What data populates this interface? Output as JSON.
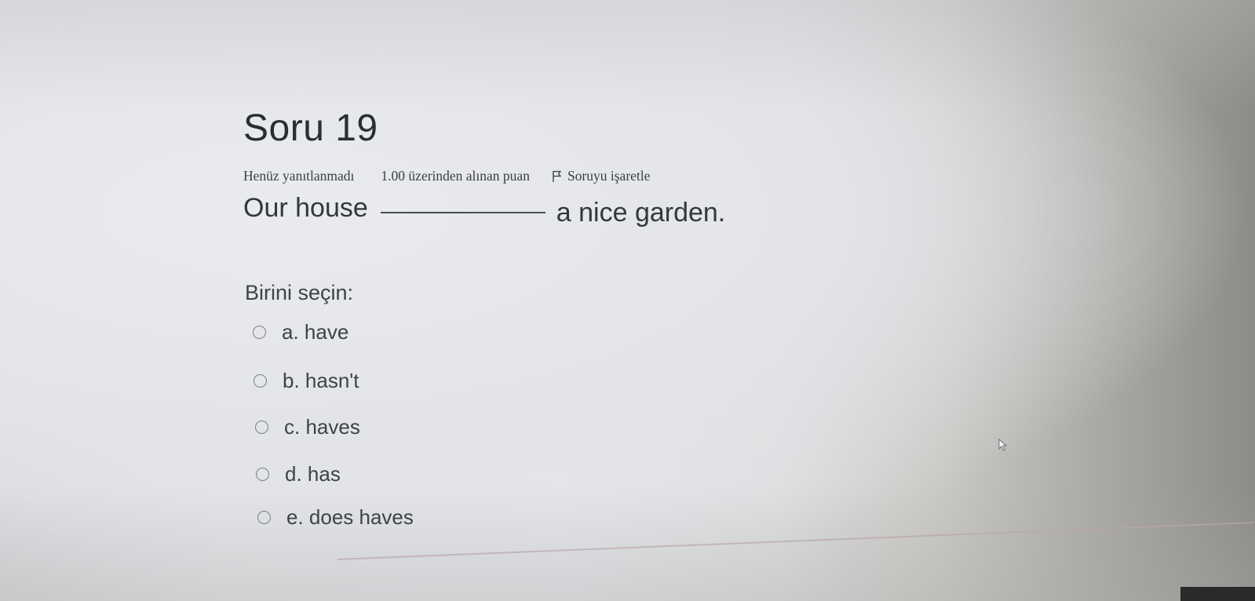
{
  "question": {
    "title": "Soru 19",
    "status": "Henüz yanıtlanmadı",
    "grade": "1.00 üzerinden alınan puan",
    "flag_label": "Soruyu işaretle",
    "text_before": "Our house",
    "text_after": "a nice garden."
  },
  "prompt": "Birini seçin:",
  "options": [
    {
      "label": "a. have"
    },
    {
      "label": "b. hasn't"
    },
    {
      "label": "c. haves"
    },
    {
      "label": "d. has"
    },
    {
      "label": "e. does haves"
    }
  ],
  "icons": {
    "flag": "flag-icon",
    "cursor": "mouse-pointer-icon"
  }
}
